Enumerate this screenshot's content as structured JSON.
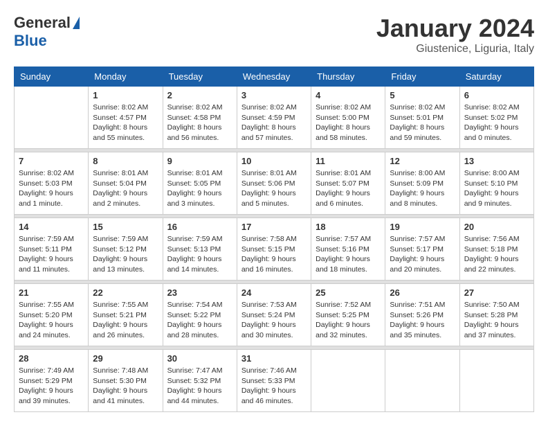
{
  "header": {
    "logo_general": "General",
    "logo_blue": "Blue",
    "month_title": "January 2024",
    "location": "Giustenice, Liguria, Italy"
  },
  "days_of_week": [
    "Sunday",
    "Monday",
    "Tuesday",
    "Wednesday",
    "Thursday",
    "Friday",
    "Saturday"
  ],
  "weeks": [
    [
      {
        "day": "",
        "sunrise": "",
        "sunset": "",
        "daylight": ""
      },
      {
        "day": "1",
        "sunrise": "Sunrise: 8:02 AM",
        "sunset": "Sunset: 4:57 PM",
        "daylight": "Daylight: 8 hours and 55 minutes."
      },
      {
        "day": "2",
        "sunrise": "Sunrise: 8:02 AM",
        "sunset": "Sunset: 4:58 PM",
        "daylight": "Daylight: 8 hours and 56 minutes."
      },
      {
        "day": "3",
        "sunrise": "Sunrise: 8:02 AM",
        "sunset": "Sunset: 4:59 PM",
        "daylight": "Daylight: 8 hours and 57 minutes."
      },
      {
        "day": "4",
        "sunrise": "Sunrise: 8:02 AM",
        "sunset": "Sunset: 5:00 PM",
        "daylight": "Daylight: 8 hours and 58 minutes."
      },
      {
        "day": "5",
        "sunrise": "Sunrise: 8:02 AM",
        "sunset": "Sunset: 5:01 PM",
        "daylight": "Daylight: 8 hours and 59 minutes."
      },
      {
        "day": "6",
        "sunrise": "Sunrise: 8:02 AM",
        "sunset": "Sunset: 5:02 PM",
        "daylight": "Daylight: 9 hours and 0 minutes."
      }
    ],
    [
      {
        "day": "7",
        "sunrise": "Sunrise: 8:02 AM",
        "sunset": "Sunset: 5:03 PM",
        "daylight": "Daylight: 9 hours and 1 minute."
      },
      {
        "day": "8",
        "sunrise": "Sunrise: 8:01 AM",
        "sunset": "Sunset: 5:04 PM",
        "daylight": "Daylight: 9 hours and 2 minutes."
      },
      {
        "day": "9",
        "sunrise": "Sunrise: 8:01 AM",
        "sunset": "Sunset: 5:05 PM",
        "daylight": "Daylight: 9 hours and 3 minutes."
      },
      {
        "day": "10",
        "sunrise": "Sunrise: 8:01 AM",
        "sunset": "Sunset: 5:06 PM",
        "daylight": "Daylight: 9 hours and 5 minutes."
      },
      {
        "day": "11",
        "sunrise": "Sunrise: 8:01 AM",
        "sunset": "Sunset: 5:07 PM",
        "daylight": "Daylight: 9 hours and 6 minutes."
      },
      {
        "day": "12",
        "sunrise": "Sunrise: 8:00 AM",
        "sunset": "Sunset: 5:09 PM",
        "daylight": "Daylight: 9 hours and 8 minutes."
      },
      {
        "day": "13",
        "sunrise": "Sunrise: 8:00 AM",
        "sunset": "Sunset: 5:10 PM",
        "daylight": "Daylight: 9 hours and 9 minutes."
      }
    ],
    [
      {
        "day": "14",
        "sunrise": "Sunrise: 7:59 AM",
        "sunset": "Sunset: 5:11 PM",
        "daylight": "Daylight: 9 hours and 11 minutes."
      },
      {
        "day": "15",
        "sunrise": "Sunrise: 7:59 AM",
        "sunset": "Sunset: 5:12 PM",
        "daylight": "Daylight: 9 hours and 13 minutes."
      },
      {
        "day": "16",
        "sunrise": "Sunrise: 7:59 AM",
        "sunset": "Sunset: 5:13 PM",
        "daylight": "Daylight: 9 hours and 14 minutes."
      },
      {
        "day": "17",
        "sunrise": "Sunrise: 7:58 AM",
        "sunset": "Sunset: 5:15 PM",
        "daylight": "Daylight: 9 hours and 16 minutes."
      },
      {
        "day": "18",
        "sunrise": "Sunrise: 7:57 AM",
        "sunset": "Sunset: 5:16 PM",
        "daylight": "Daylight: 9 hours and 18 minutes."
      },
      {
        "day": "19",
        "sunrise": "Sunrise: 7:57 AM",
        "sunset": "Sunset: 5:17 PM",
        "daylight": "Daylight: 9 hours and 20 minutes."
      },
      {
        "day": "20",
        "sunrise": "Sunrise: 7:56 AM",
        "sunset": "Sunset: 5:18 PM",
        "daylight": "Daylight: 9 hours and 22 minutes."
      }
    ],
    [
      {
        "day": "21",
        "sunrise": "Sunrise: 7:55 AM",
        "sunset": "Sunset: 5:20 PM",
        "daylight": "Daylight: 9 hours and 24 minutes."
      },
      {
        "day": "22",
        "sunrise": "Sunrise: 7:55 AM",
        "sunset": "Sunset: 5:21 PM",
        "daylight": "Daylight: 9 hours and 26 minutes."
      },
      {
        "day": "23",
        "sunrise": "Sunrise: 7:54 AM",
        "sunset": "Sunset: 5:22 PM",
        "daylight": "Daylight: 9 hours and 28 minutes."
      },
      {
        "day": "24",
        "sunrise": "Sunrise: 7:53 AM",
        "sunset": "Sunset: 5:24 PM",
        "daylight": "Daylight: 9 hours and 30 minutes."
      },
      {
        "day": "25",
        "sunrise": "Sunrise: 7:52 AM",
        "sunset": "Sunset: 5:25 PM",
        "daylight": "Daylight: 9 hours and 32 minutes."
      },
      {
        "day": "26",
        "sunrise": "Sunrise: 7:51 AM",
        "sunset": "Sunset: 5:26 PM",
        "daylight": "Daylight: 9 hours and 35 minutes."
      },
      {
        "day": "27",
        "sunrise": "Sunrise: 7:50 AM",
        "sunset": "Sunset: 5:28 PM",
        "daylight": "Daylight: 9 hours and 37 minutes."
      }
    ],
    [
      {
        "day": "28",
        "sunrise": "Sunrise: 7:49 AM",
        "sunset": "Sunset: 5:29 PM",
        "daylight": "Daylight: 9 hours and 39 minutes."
      },
      {
        "day": "29",
        "sunrise": "Sunrise: 7:48 AM",
        "sunset": "Sunset: 5:30 PM",
        "daylight": "Daylight: 9 hours and 41 minutes."
      },
      {
        "day": "30",
        "sunrise": "Sunrise: 7:47 AM",
        "sunset": "Sunset: 5:32 PM",
        "daylight": "Daylight: 9 hours and 44 minutes."
      },
      {
        "day": "31",
        "sunrise": "Sunrise: 7:46 AM",
        "sunset": "Sunset: 5:33 PM",
        "daylight": "Daylight: 9 hours and 46 minutes."
      },
      {
        "day": "",
        "sunrise": "",
        "sunset": "",
        "daylight": ""
      },
      {
        "day": "",
        "sunrise": "",
        "sunset": "",
        "daylight": ""
      },
      {
        "day": "",
        "sunrise": "",
        "sunset": "",
        "daylight": ""
      }
    ]
  ]
}
